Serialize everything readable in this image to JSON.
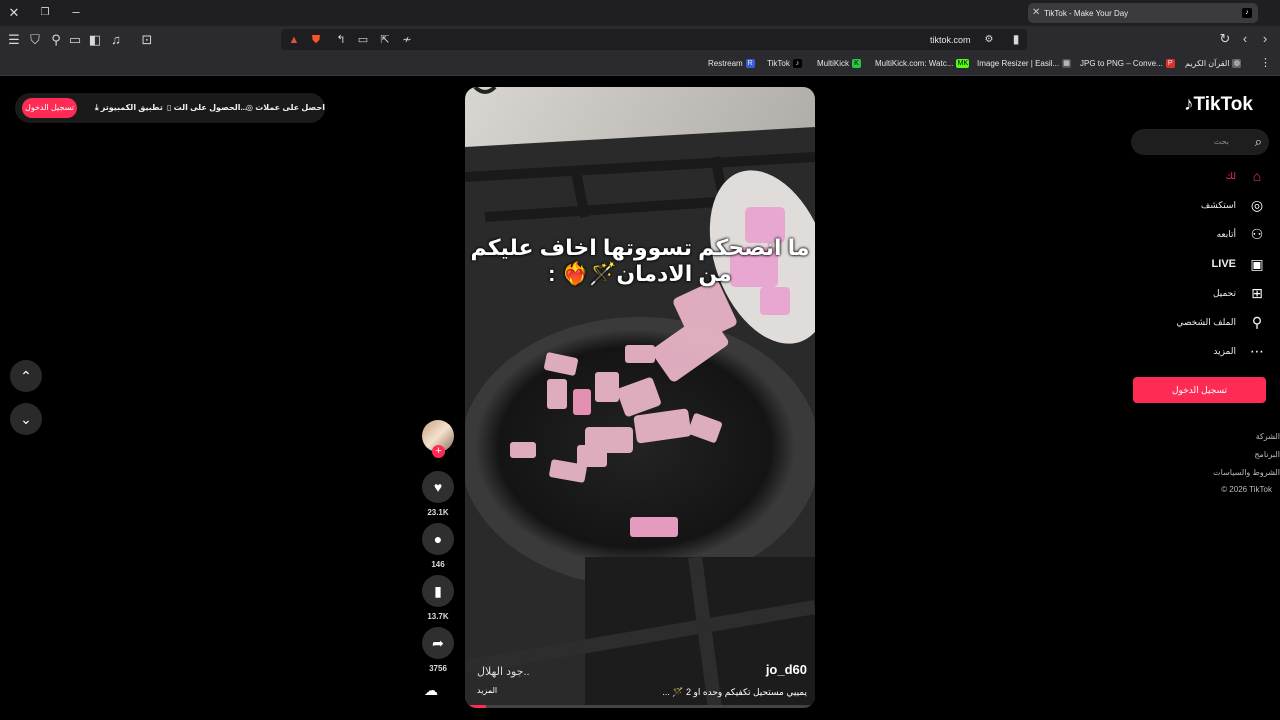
{
  "browser": {
    "tab_title": "TikTok - Make Your Day",
    "url": "tiktok.com",
    "bookmarks": [
      {
        "label": "Restream",
        "icon_letter": "R",
        "color": "#3b5bdb"
      },
      {
        "label": "TikTok",
        "icon_letter": "♪",
        "color": "#000000"
      },
      {
        "label": "MultiKick",
        "icon_letter": "K",
        "color": "#28c840"
      },
      {
        "label": "MultiKick.com: Watc...",
        "icon_letter": "MK",
        "color": "#53fc18"
      },
      {
        "label": "Image Resizer | Easil...",
        "icon_letter": "▦",
        "color": "#555555"
      },
      {
        "label": "JPG to PNG – Conve...",
        "icon_letter": "P",
        "color": "#d9332b"
      },
      {
        "label": "القرآن الكريم",
        "icon_letter": "◍",
        "color": "#666666"
      }
    ]
  },
  "topbar": {
    "login": "تسجيل الدخول",
    "desktop_app": "تطبيق الكمبيوتر",
    "get_app": "الحصول على الت...",
    "get_coins": "احصل على عملات"
  },
  "video": {
    "caption_line1": "ما انصحكم تسووتها اخاف عليكم",
    "caption_line2": "من الادمان🪄❤️‍🔥 :",
    "author": "jo_d60",
    "description": "يمييي مستحيل تكفيكم وحده او 2 🪄 ...",
    "sound": "جود الهلال..",
    "more": "المزيد",
    "progress": 0.06
  },
  "actions": {
    "likes": "23.1K",
    "comments": "146",
    "saves": "13.7K",
    "shares": "3756"
  },
  "sidebar": {
    "logo": "TikTok",
    "search_placeholder": "بحث",
    "items": [
      {
        "label": "لك",
        "icon": "home-icon",
        "active": true
      },
      {
        "label": "استكشف",
        "icon": "compass-icon"
      },
      {
        "label": "أتابعه",
        "icon": "user-plus-icon"
      },
      {
        "label": "LIVE",
        "icon": "live-icon"
      },
      {
        "label": "تحميل",
        "icon": "upload-icon"
      },
      {
        "label": "الملف الشخصي",
        "icon": "profile-icon"
      },
      {
        "label": "المزيد",
        "icon": "more-icon"
      }
    ],
    "login_button": "تسجيل الدخول",
    "footer": [
      "الشركة",
      "البرنامج",
      "الشروط والسياسات",
      "© 2026 TikTok"
    ]
  },
  "colors": {
    "accent": "#fe2c55",
    "background": "#000000"
  }
}
